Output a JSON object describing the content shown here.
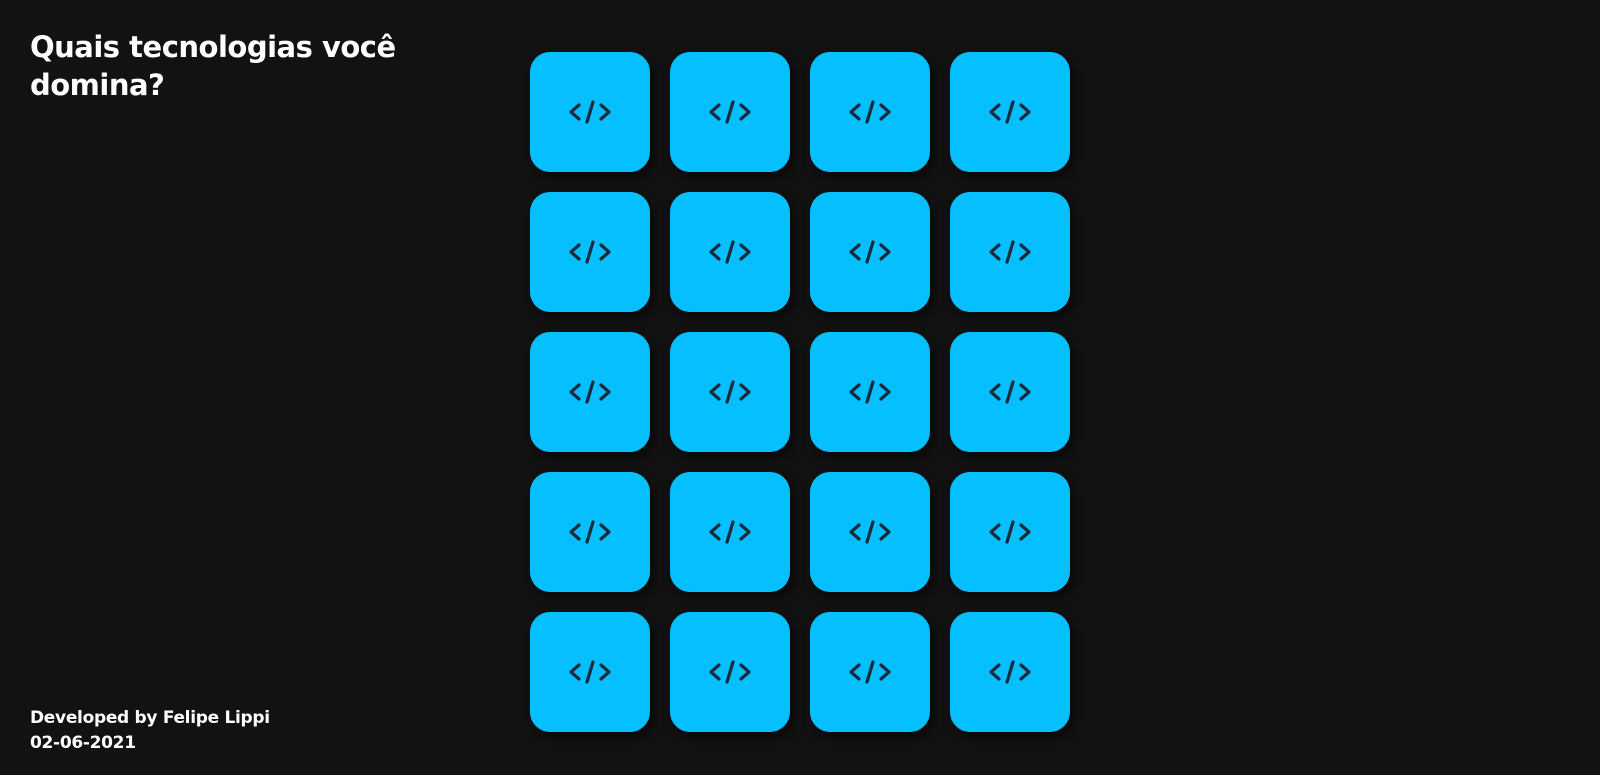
{
  "header": {
    "title": "Quais tecnologias você domina?"
  },
  "cards": [
    {
      "icon": "code-icon"
    },
    {
      "icon": "code-icon"
    },
    {
      "icon": "code-icon"
    },
    {
      "icon": "code-icon"
    },
    {
      "icon": "code-icon"
    },
    {
      "icon": "code-icon"
    },
    {
      "icon": "code-icon"
    },
    {
      "icon": "code-icon"
    },
    {
      "icon": "code-icon"
    },
    {
      "icon": "code-icon"
    },
    {
      "icon": "code-icon"
    },
    {
      "icon": "code-icon"
    },
    {
      "icon": "code-icon"
    },
    {
      "icon": "code-icon"
    },
    {
      "icon": "code-icon"
    },
    {
      "icon": "code-icon"
    },
    {
      "icon": "code-icon"
    },
    {
      "icon": "code-icon"
    },
    {
      "icon": "code-icon"
    },
    {
      "icon": "code-icon"
    }
  ],
  "footer": {
    "credit": "Developed by Felipe Lippi",
    "date": "02-06-2021"
  },
  "colors": {
    "background": "#121212",
    "card": "#05bfff",
    "icon": "#1b2a3a",
    "text": "#ffffff"
  }
}
